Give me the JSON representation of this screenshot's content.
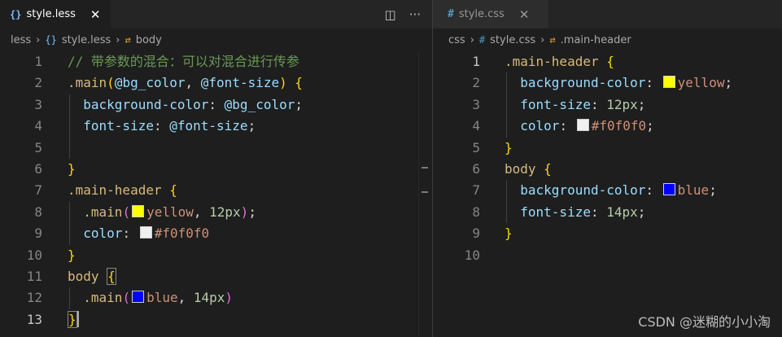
{
  "left": {
    "tab": {
      "icon": "{}",
      "label": "style.less",
      "close": "✕"
    },
    "actions": {
      "split": "◫",
      "more": "···"
    },
    "breadcrumb": {
      "folder": "less",
      "file_icon": "{}",
      "file": "style.less",
      "symbol_icon": "⇄",
      "symbol": "body"
    },
    "lines": [
      {
        "n": "1",
        "tokens": [
          {
            "t": "// 带参数的混合：可以对混合进行传参",
            "c": "c-comment"
          }
        ]
      },
      {
        "n": "2",
        "tokens": [
          {
            "t": ".main",
            "c": "c-sel"
          },
          {
            "t": "(",
            "c": "b1"
          },
          {
            "t": "@bg_color",
            "c": "c-var"
          },
          {
            "t": ", ",
            "c": "c-pun"
          },
          {
            "t": "@font-size",
            "c": "c-var"
          },
          {
            "t": ")",
            "c": "b1"
          },
          {
            "t": " ",
            "c": "c-pun"
          },
          {
            "t": "{",
            "c": "b1"
          }
        ]
      },
      {
        "n": "3",
        "tokens": [
          {
            "t": "  background-color",
            "c": "c-prop"
          },
          {
            "t": ": ",
            "c": "c-pun"
          },
          {
            "t": "@bg_color",
            "c": "c-var"
          },
          {
            "t": ";",
            "c": "c-pun"
          }
        ]
      },
      {
        "n": "4",
        "tokens": [
          {
            "t": "  font-size",
            "c": "c-prop"
          },
          {
            "t": ": ",
            "c": "c-pun"
          },
          {
            "t": "@font-size",
            "c": "c-var"
          },
          {
            "t": ";",
            "c": "c-pun"
          }
        ]
      },
      {
        "n": "5",
        "tokens": []
      },
      {
        "n": "6",
        "tokens": [
          {
            "t": "}",
            "c": "b1"
          }
        ]
      },
      {
        "n": "7",
        "tokens": [
          {
            "t": ".main-header",
            "c": "c-sel"
          },
          {
            "t": " ",
            "c": "c-pun"
          },
          {
            "t": "{",
            "c": "b1"
          }
        ]
      },
      {
        "n": "8",
        "tokens": [
          {
            "t": "  .main",
            "c": "c-sel"
          },
          {
            "t": "(",
            "c": "b2"
          },
          {
            "sw": "#ffff00"
          },
          {
            "t": "yellow",
            "c": "c-val"
          },
          {
            "t": ", ",
            "c": "c-pun"
          },
          {
            "t": "12px",
            "c": "c-num"
          },
          {
            "t": ")",
            "c": "b2"
          },
          {
            "t": ";",
            "c": "c-pun"
          }
        ]
      },
      {
        "n": "9",
        "tokens": [
          {
            "t": "  color",
            "c": "c-prop"
          },
          {
            "t": ": ",
            "c": "c-pun"
          },
          {
            "sw": "#f0f0f0"
          },
          {
            "t": "#f0f0f0",
            "c": "c-val"
          }
        ]
      },
      {
        "n": "10",
        "tokens": [
          {
            "t": "}",
            "c": "b1"
          }
        ]
      },
      {
        "n": "11",
        "tokens": [
          {
            "t": "body",
            "c": "c-sel"
          },
          {
            "t": " ",
            "c": "c-pun"
          },
          {
            "t": "{",
            "c": "b1",
            "box": true
          }
        ]
      },
      {
        "n": "12",
        "tokens": [
          {
            "t": "  .main",
            "c": "c-sel"
          },
          {
            "t": "(",
            "c": "b2"
          },
          {
            "sw": "#0000ff"
          },
          {
            "t": "blue",
            "c": "c-val"
          },
          {
            "t": ", ",
            "c": "c-pun"
          },
          {
            "t": "14px",
            "c": "c-num"
          },
          {
            "t": ")",
            "c": "b2"
          }
        ]
      },
      {
        "n": "13",
        "cur": true,
        "tokens": [
          {
            "t": "}",
            "c": "b1",
            "box": true
          },
          {
            "cursor": true
          }
        ]
      }
    ]
  },
  "right": {
    "tab": {
      "icon": "#",
      "label": "style.css",
      "close": "✕"
    },
    "breadcrumb": {
      "folder": "css",
      "file_icon": "#",
      "file": "style.css",
      "symbol_icon": "⇄",
      "symbol": ".main-header"
    },
    "lines": [
      {
        "n": "1",
        "cur": true,
        "tokens": [
          {
            "t": ".main-header",
            "c": "c-sel"
          },
          {
            "t": " ",
            "c": "c-pun"
          },
          {
            "t": "{",
            "c": "b1"
          }
        ]
      },
      {
        "n": "2",
        "tokens": [
          {
            "t": "  background-color",
            "c": "c-prop"
          },
          {
            "t": ": ",
            "c": "c-pun"
          },
          {
            "sw": "#ffff00"
          },
          {
            "t": "yellow",
            "c": "c-val"
          },
          {
            "t": ";",
            "c": "c-pun"
          }
        ]
      },
      {
        "n": "3",
        "tokens": [
          {
            "t": "  font-size",
            "c": "c-prop"
          },
          {
            "t": ": ",
            "c": "c-pun"
          },
          {
            "t": "12px",
            "c": "c-num"
          },
          {
            "t": ";",
            "c": "c-pun"
          }
        ]
      },
      {
        "n": "4",
        "tokens": [
          {
            "t": "  color",
            "c": "c-prop"
          },
          {
            "t": ": ",
            "c": "c-pun"
          },
          {
            "sw": "#f0f0f0"
          },
          {
            "t": "#f0f0f0",
            "c": "c-val"
          },
          {
            "t": ";",
            "c": "c-pun"
          }
        ]
      },
      {
        "n": "5",
        "tokens": [
          {
            "t": "}",
            "c": "b1"
          }
        ]
      },
      {
        "n": "6",
        "tokens": [
          {
            "t": "body",
            "c": "c-sel"
          },
          {
            "t": " ",
            "c": "c-pun"
          },
          {
            "t": "{",
            "c": "b1"
          }
        ]
      },
      {
        "n": "7",
        "tokens": [
          {
            "t": "  background-color",
            "c": "c-prop"
          },
          {
            "t": ": ",
            "c": "c-pun"
          },
          {
            "sw": "#0000ff"
          },
          {
            "t": "blue",
            "c": "c-val"
          },
          {
            "t": ";",
            "c": "c-pun"
          }
        ]
      },
      {
        "n": "8",
        "tokens": [
          {
            "t": "  font-size",
            "c": "c-prop"
          },
          {
            "t": ": ",
            "c": "c-pun"
          },
          {
            "t": "14px",
            "c": "c-num"
          },
          {
            "t": ";",
            "c": "c-pun"
          }
        ]
      },
      {
        "n": "9",
        "tokens": [
          {
            "t": "}",
            "c": "b1"
          }
        ]
      },
      {
        "n": "10",
        "tokens": []
      }
    ]
  },
  "watermark": "CSDN @迷糊的小小淘"
}
